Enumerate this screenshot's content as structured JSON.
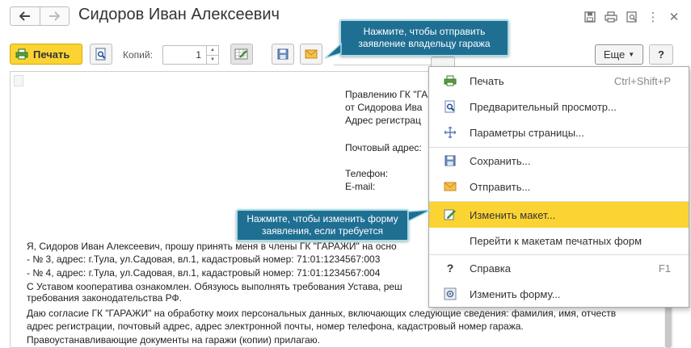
{
  "window": {
    "title": "Сидоров Иван Алексеевич",
    "back_icon": "arrow-left-icon",
    "forward_icon": "arrow-right-icon"
  },
  "toolbar": {
    "print_label": "Печать",
    "copies_label": "Копий:",
    "copies_value": "1",
    "more_label": "Еще",
    "help_label": "?"
  },
  "colors": {
    "accent_yellow": "#fbd434",
    "callout_blue": "#1f6f93",
    "callout_border": "#a8dde6"
  },
  "callouts": {
    "send": "Нажмите, чтобы отправить заявление владельцу гаража",
    "edit": "Нажмите, чтобы изменить форму заявления, если требуется"
  },
  "menu": {
    "items": [
      {
        "label": "Печать",
        "shortcut": "Ctrl+Shift+P",
        "icon": "printer-icon"
      },
      {
        "label": "Предварительный просмотр...",
        "shortcut": "",
        "icon": "preview-icon"
      },
      {
        "label": "Параметры страницы...",
        "shortcut": "",
        "icon": "page-setup-icon"
      },
      {
        "label": "Сохранить...",
        "shortcut": "",
        "icon": "save-icon"
      },
      {
        "label": "Отправить...",
        "shortcut": "",
        "icon": "envelope-icon"
      },
      {
        "label": "Изменить макет...",
        "shortcut": "",
        "icon": "edit-icon"
      },
      {
        "label": "Перейти к макетам печатных форм",
        "shortcut": "",
        "icon": ""
      },
      {
        "label": "Справка",
        "shortcut": "F1",
        "icon": "help-icon"
      },
      {
        "label": "Изменить форму...",
        "shortcut": "",
        "icon": "form-settings-icon"
      }
    ]
  },
  "document": {
    "header_lines": [
      "Правлению ГК \"ГА",
      "от Сидорова Ива",
      "Адрес регистрац",
      "Почтовый адрес:",
      "Телефон:",
      "E-mail:"
    ],
    "body_lines": [
      "Я, Сидоров Иван Алексеевич, прошу принять меня в члены ГК \"ГАРАЖИ\" на осно",
      "- № 3, адрес: г.Тула, ул.Садовая, вл.1, кадастровый номер: 71:01:1234567:003",
      "- № 4, адрес: г.Тула, ул.Садовая, вл.1, кадастровый номер: 71:01:1234567:004",
      "С Уставом кооператива ознакомлен. Обязуюсь выполнять требования Устава, реш",
      "требования законодательства РФ.",
      "Даю согласие ГК \"ГАРАЖИ\" на обработку моих персональных данных, включающих следующие сведения: фамилия, имя, отчеств",
      "адрес регистрации, почтовый адрес, адрес электронной почты, номер телефона, кадастровый номер гаража.",
      "Правоустанавливающие документы на гаражи (копии) прилагаю."
    ]
  }
}
